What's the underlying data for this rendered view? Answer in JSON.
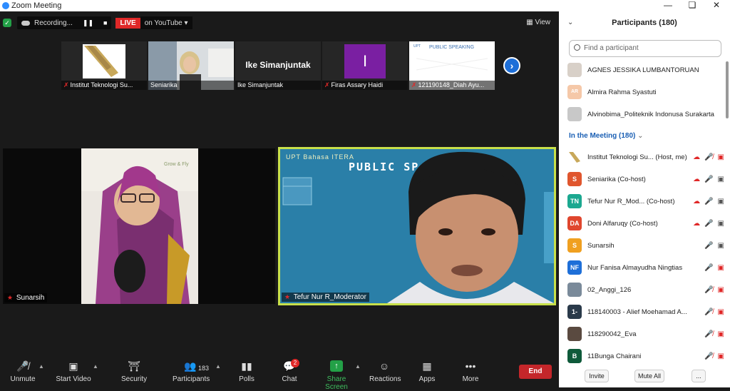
{
  "window": {
    "title": "Zoom Meeting"
  },
  "topbar": {
    "recording_label": "Recording...",
    "live_label": "LIVE",
    "stream_label": "on YouTube",
    "view_label": "View"
  },
  "thumbs": [
    {
      "name": "Institut Teknologi Su..."
    },
    {
      "name": "Seniarika"
    },
    {
      "name": "Ike Simanjuntak",
      "display": "Ike Simanjuntak"
    },
    {
      "name": "Firas Assary Haidi",
      "initial": "I"
    },
    {
      "name": "121190148_Diah Ayu..."
    }
  ],
  "tiles": {
    "left_label": "Sunarsih",
    "right_label": "Tefur  Nur R_Moderator",
    "right_banner": "UPT Bahasa ITERA",
    "right_title": "PUBLIC SP"
  },
  "toolbar": {
    "unmute": "Unmute",
    "start_video": "Start Video",
    "security": "Security",
    "participants": "Participants",
    "participants_count": "183",
    "polls": "Polls",
    "chat": "Chat",
    "chat_badge": "2",
    "share_screen": "Share Screen",
    "reactions": "Reactions",
    "apps": "Apps",
    "more": "More",
    "end": "End"
  },
  "panel": {
    "title": "Participants (180)",
    "search_placeholder": "Find a participant",
    "waiting": [
      {
        "name": "AGNES JESSIKA LUMBANTORUAN"
      },
      {
        "name": "Almira Rahma Syastuti",
        "initials": "AR"
      },
      {
        "name": "Alvinobima_Politeknik Indonusa Surakarta"
      }
    ],
    "section_label": "In the Meeting (180)",
    "members": [
      {
        "name": "Institut Teknologi Su... (Host, me)"
      },
      {
        "name": "Seniarika (Co-host)",
        "initials": "S"
      },
      {
        "name": "Tefur  Nur R_Mod... (Co-host)",
        "initials": "TN"
      },
      {
        "name": "Doni Alfaruqy (Co-host)",
        "initials": "DA"
      },
      {
        "name": "Sunarsih",
        "initials": "S"
      },
      {
        "name": "Nur Fanisa Almayudha Ningtias",
        "initials": "NF"
      },
      {
        "name": "02_Anggi_126"
      },
      {
        "name": "118140003 - Alief Moehamad A...",
        "initials": "1-"
      },
      {
        "name": "118290042_Eva"
      },
      {
        "name": "11Bunga Chairani",
        "initials": "B"
      }
    ],
    "invite_label": "Invite",
    "mute_all_label": "Mute All",
    "more_label": "..."
  }
}
